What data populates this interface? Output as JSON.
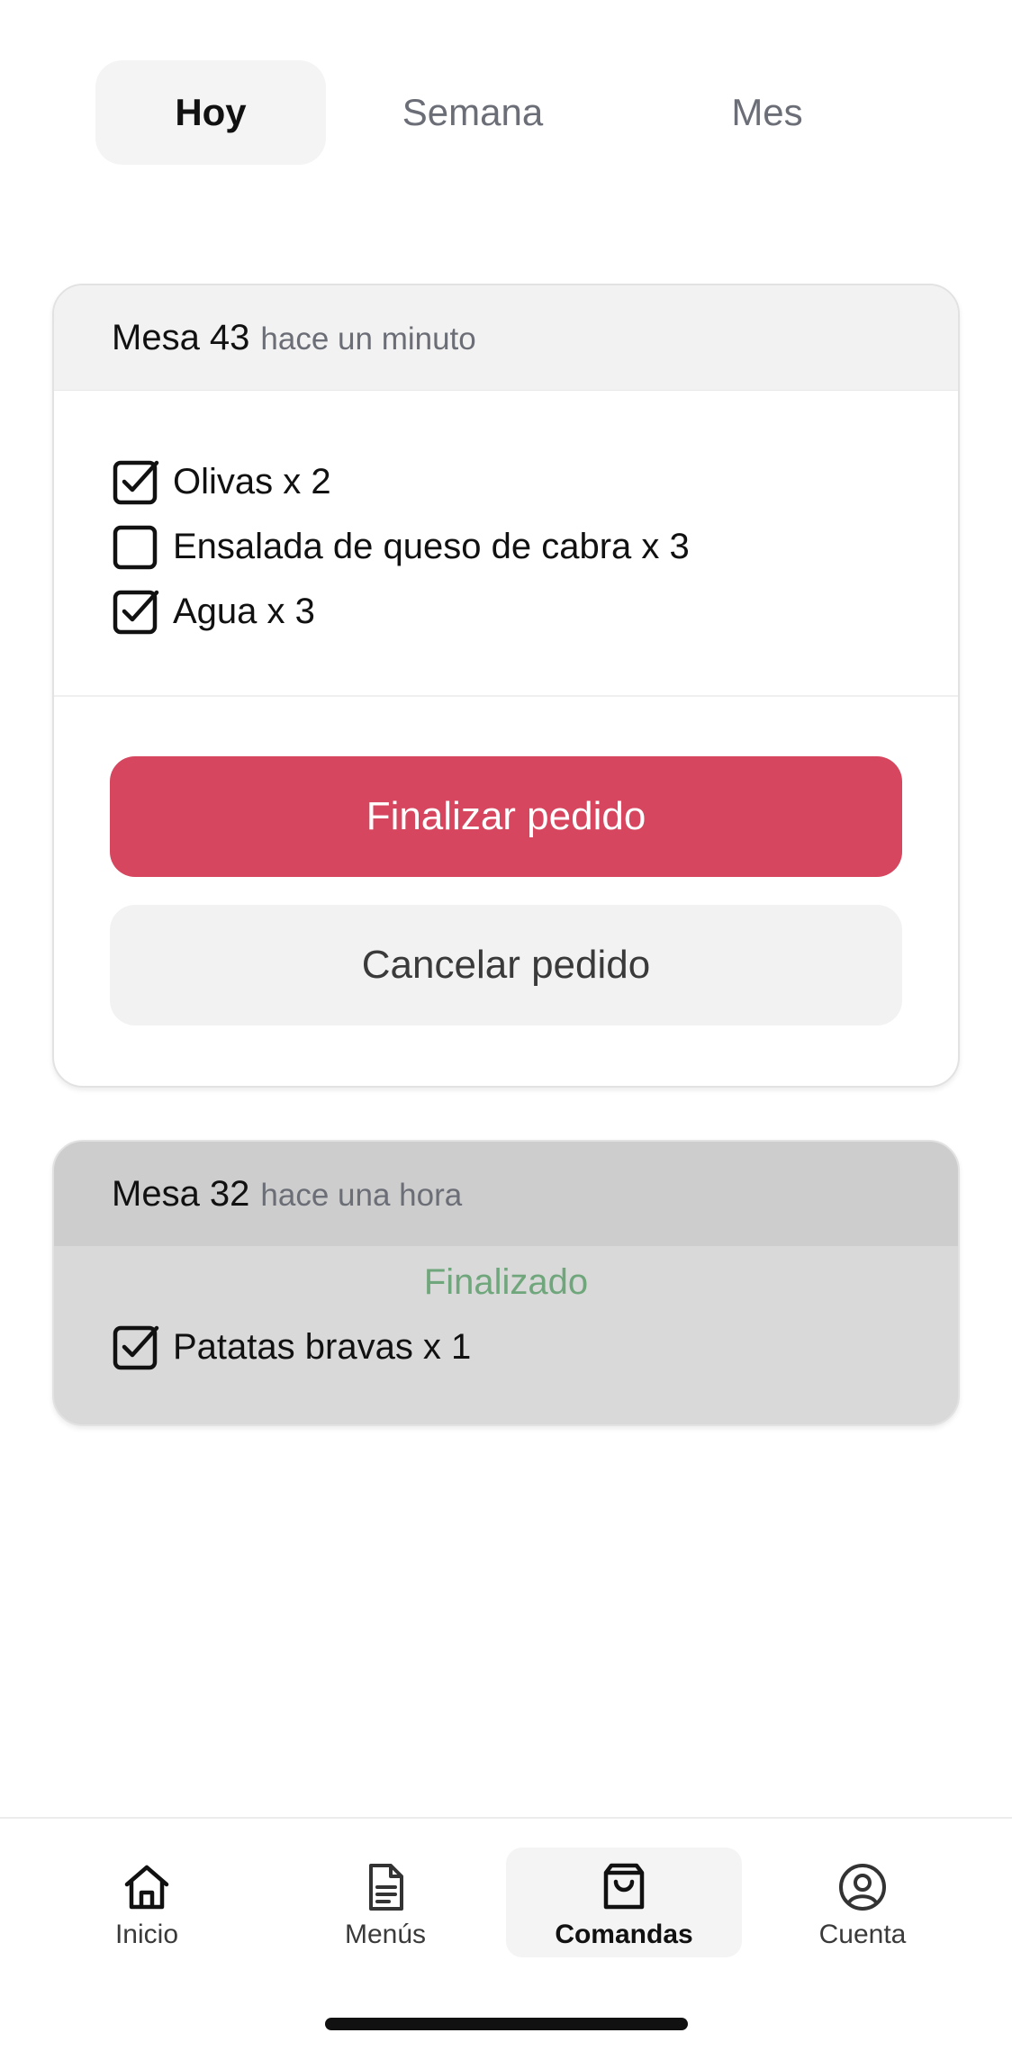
{
  "tabs": [
    {
      "label": "Hoy",
      "active": true
    },
    {
      "label": "Semana",
      "active": false
    },
    {
      "label": "Mes",
      "active": false
    }
  ],
  "orders": [
    {
      "table": "Mesa 43",
      "time": "hace un minuto",
      "items": [
        {
          "label": "Olivas x 2",
          "checked": true
        },
        {
          "label": "Ensalada de queso de cabra x 3",
          "checked": false
        },
        {
          "label": "Agua x 3",
          "checked": true
        }
      ],
      "finish_label": "Finalizar pedido",
      "cancel_label": "Cancelar pedido"
    },
    {
      "table": "Mesa 32",
      "time": "hace una hora",
      "status": "Finalizado",
      "items": [
        {
          "label": "Patatas bravas x 1",
          "checked": true
        }
      ]
    }
  ],
  "nav": [
    {
      "label": "Inicio",
      "icon": "home-icon",
      "active": false
    },
    {
      "label": "Menús",
      "icon": "document-icon",
      "active": false
    },
    {
      "label": "Comandas",
      "icon": "shopping-bag-icon",
      "active": true
    },
    {
      "label": "Cuenta",
      "icon": "user-circle-icon",
      "active": false
    }
  ],
  "colors": {
    "accent": "#d6465e",
    "status_done": "#6fa67b",
    "tab_active_bg": "#f4f4f5",
    "card_done_bg": "#d9d9d9"
  }
}
